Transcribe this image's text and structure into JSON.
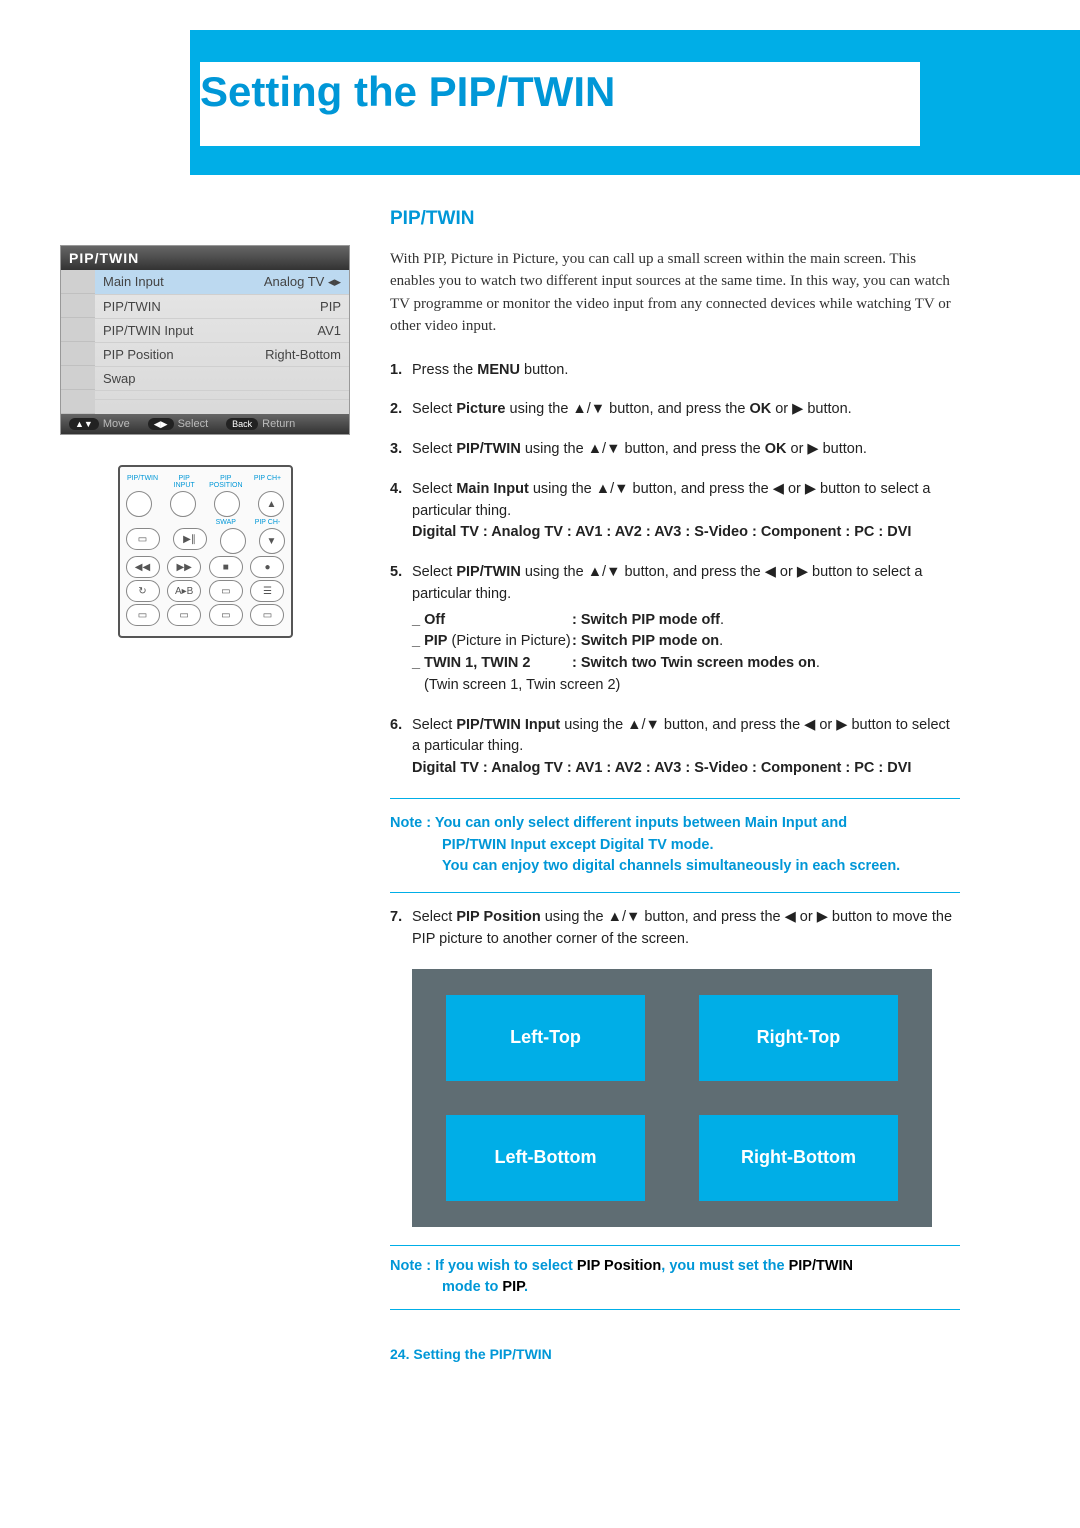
{
  "page": {
    "title": "Setting the PIP/TWIN",
    "section_heading": "PIP/TWIN",
    "intro": "With PIP, Picture in Picture, you can call up a small screen within the main screen. This enables you to watch two different input sources at the same time. In this way, you can watch TV programme or monitor the video input from any connected devices while watching TV or other video input.",
    "footer": "24. Setting the PIP/TWIN"
  },
  "osd": {
    "title": "PIP/TWIN",
    "rows": [
      {
        "label": "Main Input",
        "value": "Analog TV ◂▸",
        "active": true
      },
      {
        "label": "PIP/TWIN",
        "value": "PIP"
      },
      {
        "label": "PIP/TWIN Input",
        "value": "AV1"
      },
      {
        "label": "PIP Position",
        "value": "Right-Bottom"
      },
      {
        "label": "Swap",
        "value": ""
      },
      {
        "label": "",
        "value": ""
      }
    ],
    "footer": {
      "move": "Move",
      "select": "Select",
      "back": "Back",
      "return": "Return"
    }
  },
  "remote": {
    "top_labels": [
      "PIP/TWIN",
      "PIP INPUT",
      "PIP POSITION",
      "PIP CH+"
    ],
    "mid_labels_left": "SWAP",
    "mid_labels_right": "PIP CH-"
  },
  "steps": {
    "s1": {
      "num": "1.",
      "a": "Press the ",
      "b": "MENU",
      "c": " button."
    },
    "s2": {
      "num": "2.",
      "a": "Select ",
      "b": "Picture",
      "c": " using the ▲/▼ button, and press the ",
      "d": "OK",
      "e": " or ▶ button."
    },
    "s3": {
      "num": "3.",
      "a": "Select ",
      "b": "PIP/TWIN",
      "c": " using the ▲/▼ button, and press the ",
      "d": "OK",
      "e": " or ▶ button."
    },
    "s4": {
      "num": "4.",
      "a": "Select ",
      "b": "Main Input",
      "c": " using the ▲/▼ button, and press the ◀ or ▶ button to select a particular thing.",
      "opts": "Digital TV : Analog TV : AV1 : AV2 : AV3 : S-Video : Component : PC : DVI"
    },
    "s5": {
      "num": "5.",
      "a": "Select ",
      "b": "PIP/TWIN",
      "c": " using the ▲/▼ button, and press the ◀ or ▶ button to select a particular thing.",
      "rows": [
        {
          "k": "_ Off",
          "v": ": Switch PIP mode off",
          "suffix": "."
        },
        {
          "k": "_ PIP",
          "paren": " (Picture in Picture) ",
          "v": ": Switch PIP mode on",
          "suffix": "."
        },
        {
          "k": "_ TWIN 1, TWIN 2",
          "v": ": Switch two Twin screen modes on",
          "suffix": "."
        }
      ],
      "tail": "(Twin screen 1, Twin screen 2)"
    },
    "s6": {
      "num": "6.",
      "a": "Select ",
      "b": "PIP/TWIN Input",
      "c": " using the ▲/▼ button, and press the ◀ or ▶ button to select a particular thing.",
      "opts": "Digital TV : Analog TV : AV1 : AV2 : AV3 : S-Video : Component : PC : DVI"
    },
    "s7": {
      "num": "7.",
      "a": "Select ",
      "b": "PIP Position",
      "c": " using the ▲/▼ button, and press the ◀ or ▶ button to move the PIP picture to another corner of the screen."
    }
  },
  "note1": {
    "label": "Note : ",
    "l1": "You can only select different inputs between Main Input and",
    "l2": "PIP/TWIN Input except Digital TV mode.",
    "l3": "You can enjoy two digital channels simultaneously in each screen."
  },
  "positions": {
    "lt": "Left-Top",
    "rt": "Right-Top",
    "lb": "Left-Bottom",
    "rb": "Right-Bottom"
  },
  "note2": {
    "label": "Note : ",
    "a": "If you wish to select ",
    "b": "PIP Position",
    "c": ", you must set the ",
    "d": "PIP/TWIN",
    "e": " mode to ",
    "f": "PIP",
    "g": "."
  }
}
